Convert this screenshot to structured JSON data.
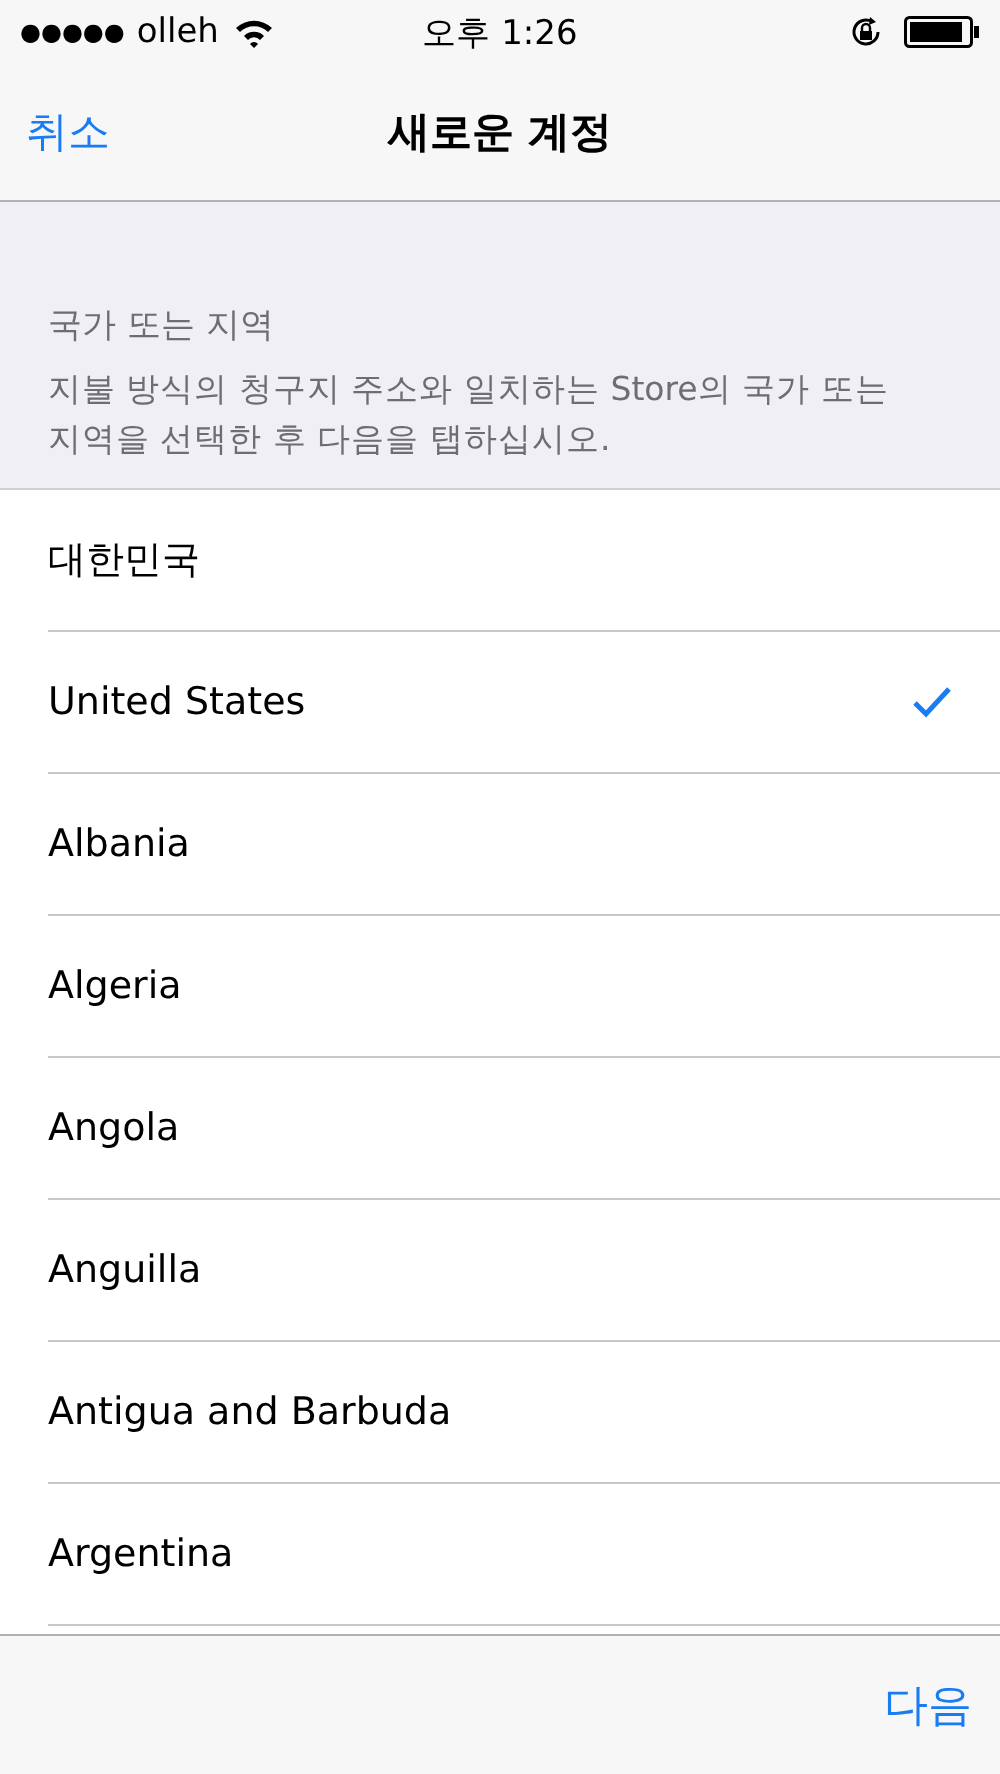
{
  "status_bar": {
    "carrier": "olleh",
    "signal_dots": "●●●●●",
    "time": "오후 1:26"
  },
  "nav": {
    "cancel": "취소",
    "title": "새로운 계정"
  },
  "section": {
    "header": "국가 또는 지역",
    "description": "지불 방식의 청구지 주소와 일치하는 Store의 국가 또는 지역을 선택한 후 다음을 탭하십시오."
  },
  "countries": [
    {
      "name": "대한민국",
      "selected": false
    },
    {
      "name": "United States",
      "selected": true
    },
    {
      "name": "Albania",
      "selected": false
    },
    {
      "name": "Algeria",
      "selected": false
    },
    {
      "name": "Angola",
      "selected": false
    },
    {
      "name": "Anguilla",
      "selected": false
    },
    {
      "name": "Antigua and Barbuda",
      "selected": false
    },
    {
      "name": "Argentina",
      "selected": false
    }
  ],
  "toolbar": {
    "next": "다음"
  }
}
